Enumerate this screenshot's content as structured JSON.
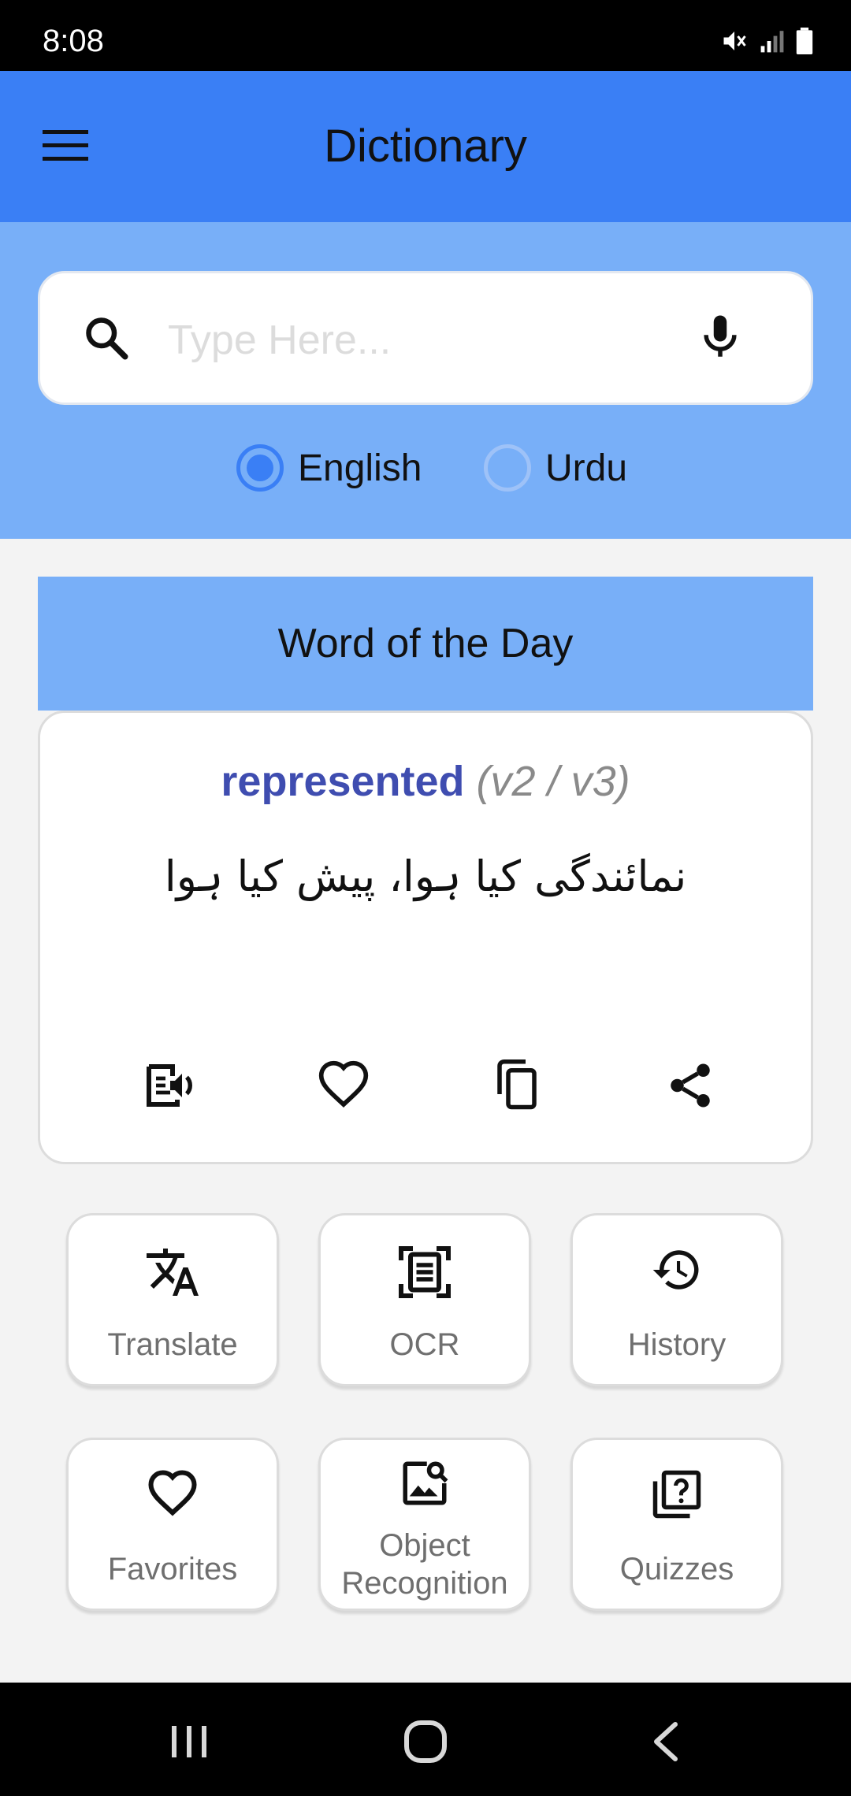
{
  "status_bar": {
    "time": "8:08",
    "icons": [
      "mute-icon",
      "signal-icon",
      "battery-icon"
    ]
  },
  "app_bar": {
    "title": "Dictionary",
    "menu_icon": "hamburger-menu-icon"
  },
  "search": {
    "placeholder": "Type Here...",
    "value": "",
    "search_icon": "search-icon",
    "mic_icon": "microphone-icon"
  },
  "language": {
    "options": [
      {
        "label": "English",
        "selected": true
      },
      {
        "label": "Urdu",
        "selected": false
      }
    ]
  },
  "word_of_the_day": {
    "header": "Word of the Day",
    "word": "represented",
    "forms": "(v2 / v3)",
    "meaning": "نمائندگی کیا ہوا، پیش کیا ہوا",
    "actions": [
      "speak-icon",
      "favorite-icon",
      "copy-icon",
      "share-icon"
    ]
  },
  "features": [
    {
      "label": "Translate",
      "icon": "translate-icon"
    },
    {
      "label": "OCR",
      "icon": "ocr-scan-icon"
    },
    {
      "label": "History",
      "icon": "history-icon"
    },
    {
      "label": "Favorites",
      "icon": "heart-icon"
    },
    {
      "label": "Object\nRecognition",
      "label_line1": "Object",
      "label_line2": "Recognition",
      "icon": "image-search-icon"
    },
    {
      "label": "Quizzes",
      "icon": "quiz-icon"
    }
  ],
  "nav_bar": {
    "buttons": [
      "recent-apps-icon",
      "home-icon",
      "back-icon"
    ]
  },
  "colors": {
    "app_bar": "#3a7ff5",
    "panel": "#78aff8",
    "word": "#3f4db0",
    "background": "#f3f3f3"
  }
}
